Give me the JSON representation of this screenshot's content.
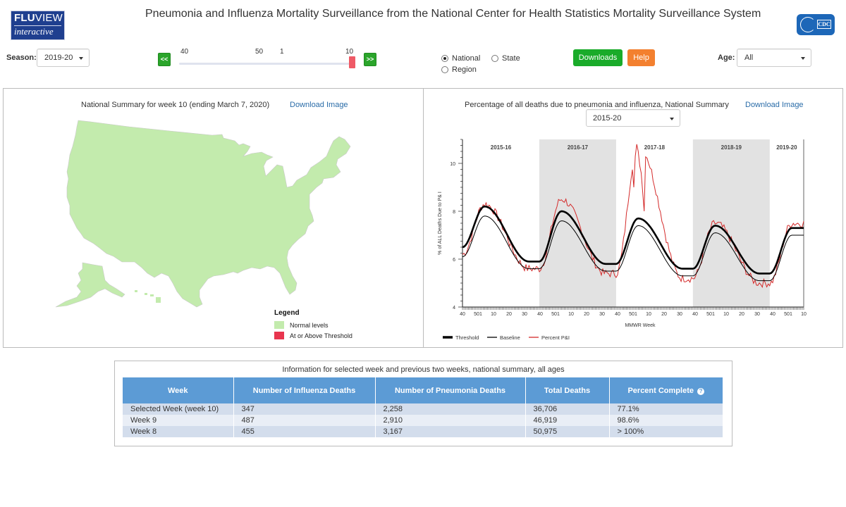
{
  "header": {
    "logo_line1_bold": "FLU",
    "logo_line1_thin": "VIEW",
    "logo_line2": "interactive",
    "title": "Pneumonia and Influenza Mortality Surveillance from the National Center for Health Statistics Mortality Surveillance System",
    "agency_logo_text": "CDC"
  },
  "controls": {
    "season_label": "Season:",
    "season_value": "2019-20",
    "prev_button": "<<",
    "next_button": ">>",
    "week_slider": {
      "tick_labels": [
        "40",
        "50",
        "1",
        "10"
      ],
      "selected_week": "10"
    },
    "geography_options": [
      {
        "label": "National",
        "selected": true
      },
      {
        "label": "State",
        "selected": false
      },
      {
        "label": "Region",
        "selected": false
      }
    ],
    "downloads_button": "Downloads",
    "help_button": "Help",
    "age_label": "Age:",
    "age_value": "All",
    "colors": {
      "downloads": "#1aab2a",
      "help": "#f3802f",
      "nav": "#2ba52b",
      "slider_handle": "#ef5a66"
    }
  },
  "map_panel": {
    "title": "National Summary for week 10 (ending March 7, 2020)",
    "download_link": "Download Image",
    "legend": {
      "title": "Legend",
      "items": [
        {
          "label": "Normal levels",
          "color": "#c3ebad"
        },
        {
          "label": "At or Above Threshold",
          "color": "#e8354e"
        }
      ]
    }
  },
  "chart_panel": {
    "title": "Percentage of all deaths due to pneumonia and influenza, National Summary",
    "download_link": "Download Image",
    "range_value": "2015-20"
  },
  "chart_data": {
    "type": "line",
    "title": "Percentage of all deaths due to pneumonia and influenza, National Summary",
    "xlabel": "MMWR Week",
    "ylabel": "% of ALL Deaths Due to P& I",
    "ylim": [
      4,
      11
    ],
    "yticks": [
      4,
      6,
      8,
      10
    ],
    "xtick_labels": [
      "40",
      "501",
      "10",
      "20",
      "30",
      "40",
      "501",
      "10",
      "20",
      "30",
      "40",
      "501",
      "10",
      "20",
      "30",
      "40",
      "501",
      "10",
      "20",
      "30",
      "40",
      "501",
      "10"
    ],
    "seasons": [
      {
        "label": "2015-16",
        "shaded": false
      },
      {
        "label": "2016-17",
        "shaded": true
      },
      {
        "label": "2017-18",
        "shaded": false
      },
      {
        "label": "2018-19",
        "shaded": true
      },
      {
        "label": "2019-20",
        "shaded": false
      }
    ],
    "grid": false,
    "legend_position": "bottom-left",
    "series": [
      {
        "name": "Threshold",
        "color": "#000000",
        "style": "thick",
        "season_min": [
          5.9,
          5.8,
          5.6,
          5.4
        ],
        "season_peak": [
          8.2,
          8.0,
          7.7,
          7.4,
          7.3
        ],
        "peak_week_offset": 15
      },
      {
        "name": "Baseline",
        "color": "#000000",
        "style": "thin",
        "season_min": [
          5.6,
          5.5,
          5.3,
          5.1
        ],
        "season_peak": [
          7.8,
          7.6,
          7.4,
          7.1,
          7.0
        ],
        "peak_week_offset": 15
      },
      {
        "name": "Percent P&I",
        "color": "#d42a2a",
        "style": "thin",
        "season_peak": [
          8.3,
          8.5,
          10.8,
          7.5,
          7.5
        ],
        "season_min": [
          5.6,
          5.4,
          5.2,
          5.0
        ],
        "end_value": 7.1
      }
    ]
  },
  "table": {
    "caption": "Information for selected week and previous two weeks, national summary, all ages",
    "headers": [
      "Week",
      "Number of Influenza Deaths",
      "Number of Pneumonia Deaths",
      "Total Deaths",
      "Percent Complete"
    ],
    "rows": [
      [
        "Selected Week (week 10)",
        "347",
        "2,258",
        "36,706",
        "77.1%"
      ],
      [
        "Week 9",
        "487",
        "2,910",
        "46,919",
        "98.6%"
      ],
      [
        "Week 8",
        "455",
        "3,167",
        "50,975",
        "> 100%"
      ]
    ],
    "header_help_icon": "?"
  }
}
